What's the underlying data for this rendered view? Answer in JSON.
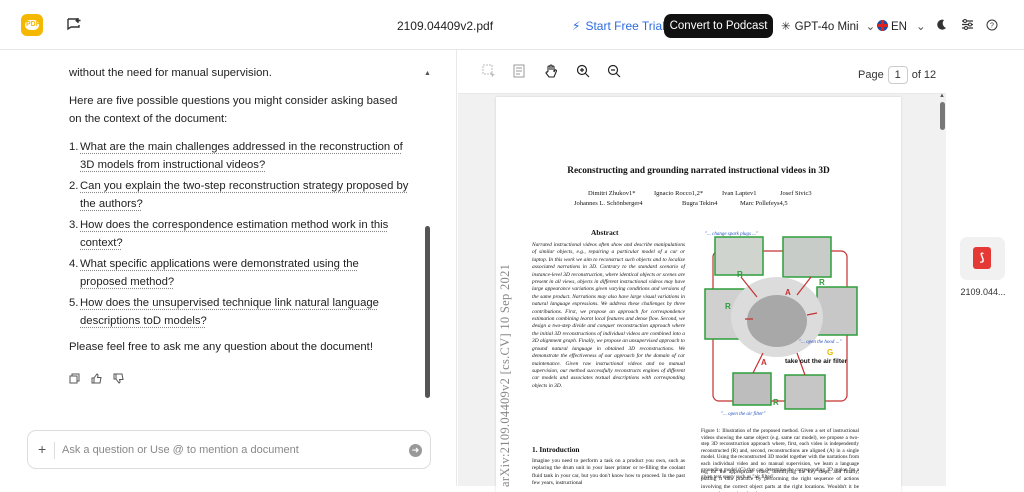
{
  "header": {
    "logo_text": "PDF",
    "filename": "2109.04409v2.pdf",
    "trial_label": "Start Free Trial",
    "convert_label": "Convert to Podcast",
    "model_label": "GPT-4o Mini",
    "language_label": "EN",
    "accent": "#2d6cdf"
  },
  "chat": {
    "intro_line": "without the need for manual supervision.",
    "lead": "Here are five possible questions you might consider asking based on the context of the document:",
    "questions": [
      {
        "n": "1.",
        "text": "What are the main challenges addressed in the reconstruction of 3D models from instructional videos?"
      },
      {
        "n": "2.",
        "text": "Can you explain the two-step reconstruction strategy proposed by the authors?"
      },
      {
        "n": "3.",
        "text": "How does the correspondence estimation method work in this context?"
      },
      {
        "n": "4.",
        "text": "What specific applications were demonstrated using the proposed method?"
      },
      {
        "n": "5.",
        "text": "How does the unsupervised technique link natural language descriptions toD models?"
      }
    ],
    "closing": "Please feel free to ask me any question about the document!",
    "input_placeholder": "Ask a question or Use @ to mention a document"
  },
  "viewer": {
    "page_label": "Page",
    "page_current": "1",
    "page_total": "of 12"
  },
  "paper": {
    "title": "Reconstructing and grounding narrated instructional videos in 3D",
    "authors_row1": [
      "Dimitri Zhukov1*",
      "Ignacio Rocco1,2*",
      "Ivan Laptev1",
      "Josef Sivic3"
    ],
    "authors_row2": [
      "Johannes L. Schönberger4",
      "Bugra Tekin4",
      "Marc Pollefeys4,5"
    ],
    "arxiv_stamp": "arXiv:2109.04409v2  [cs.CV]  10 Sep 2021",
    "abstract_head": "Abstract",
    "abstract": "Narrated instructional videos often show and describe manipulations of similar objects, e.g., repairing a particular model of a car or laptop. In this work we aim to reconstruct such objects and to localize associated narrations in 3D. Contrary to the standard scenario of instance-level 3D reconstruction, where identical objects or scenes are present in all views, objects in different instructional videos may have large appearance variations given varying conditions and versions of the same product. Narrations may also have large visual variations in natural language expressions. We address these challenges by three contributions. First, we propose an approach for correspondence estimation combining learnt local features and dense flow. Second, we design a two-step divide and conquer reconstruction approach where the initial 3D reconstructions of individual videos are combined into a 3D alignment graph. Finally, we propose an unsupervised approach to ground natural language in obtained 3D reconstructions. We demonstrate the effectiveness of our approach for the domain of car maintenance. Given raw instructional videos and no manual supervision, our method successfully reconstructs engines of different car models and associates textual descriptions with corresponding objects in 3D.",
    "intro_head": "1. Introduction",
    "intro_text": "Imagine you need to perform a task on a product you own, such as replacing the drum unit in your laser printer or re-filling the coolant fluid tank in your car, but you don't know how to proceed. In the past few years, instructional",
    "figure_labels": {
      "spark": "\"... change spark plugs ...\"",
      "hood": "\"... open the hood ...\"",
      "airfilter": "take out the air filter",
      "openair": "\"... open the air filter\"",
      "R": "R",
      "A": "A",
      "G": "G"
    },
    "caption": "Figure 1: Illustration of the proposed method. Given a set of instructional videos showing the same object (e.g. same car model), we propose a two-step 3D reconstruction approach where, first, each video is independently reconstructed (R) and, second, reconstructions are aligned (A) in a single model. Using the reconstructed 3D model together with the narrations from each individual video and no manual supervision, we learn a language grounding model (G) that can determine the corresponding 3D region for a given text query such as \"air filter\".",
    "right_text": "ing for the appropriate video, identifying the key steps, and finally, putting it into practice by performing the right sequence of actions involving the correct object parts at the right locations. Wouldn't it be great to have a virtual assis-"
  },
  "files": {
    "card_label": "2109.044..."
  }
}
